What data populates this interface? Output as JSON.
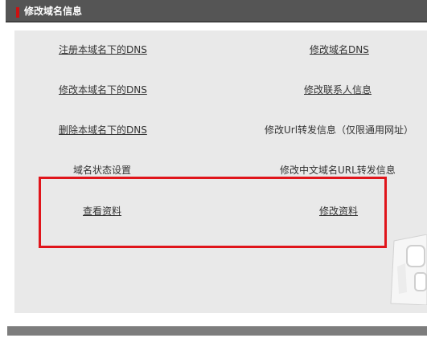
{
  "header": {
    "title": "修改域名信息",
    "accent_color": "#cc1111"
  },
  "links": {
    "register_dns": "注册本域名下的DNS",
    "modify_domain_dns": "修改域名DNS",
    "modify_dns": "修改本域名下的DNS",
    "modify_contact": "修改联系人信息",
    "delete_dns": "删除本域名下的DNS",
    "url_forward": "修改Url转发信息（仅限通用网址）",
    "domain_status": "域名状态设置",
    "cn_url_forward": "修改中文域名URL转发信息",
    "view_info": "查看资料",
    "modify_info": "修改资料"
  },
  "highlight_color": "#e0151b"
}
